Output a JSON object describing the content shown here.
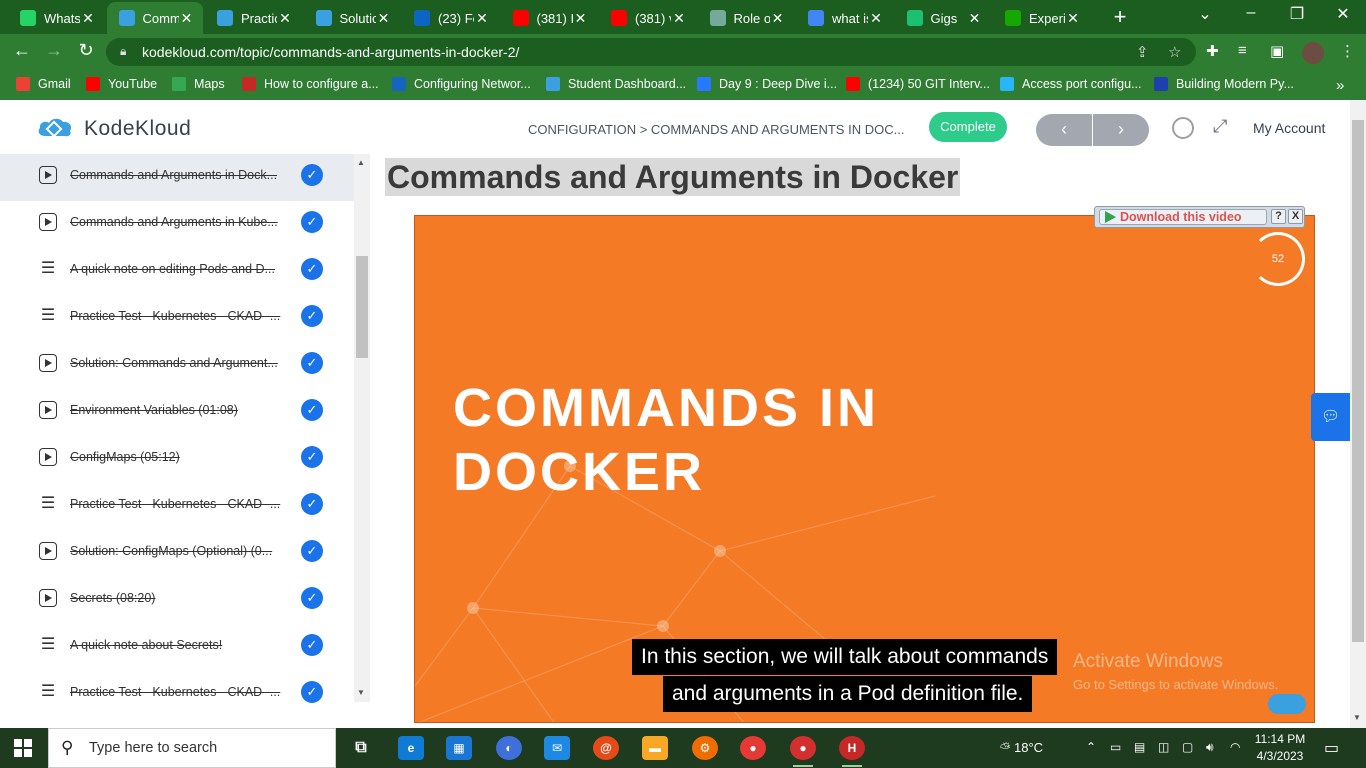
{
  "browser": {
    "tabs": [
      {
        "title": "Whats",
        "icon": "whatsapp-icon",
        "color": "#25d366",
        "active": false
      },
      {
        "title": "Comm",
        "icon": "kodekloud-icon",
        "color": "#3aa0e0",
        "active": true
      },
      {
        "title": "Practic",
        "icon": "kodekloud-icon",
        "color": "#3aa0e0",
        "active": false
      },
      {
        "title": "Solutic",
        "icon": "kodekloud-icon",
        "color": "#3aa0e0",
        "active": false
      },
      {
        "title": "(23) Fe",
        "icon": "linkedin-icon",
        "color": "#0a66c2",
        "active": false
      },
      {
        "title": "(381) I",
        "icon": "youtube-icon",
        "color": "#ff0000",
        "active": false
      },
      {
        "title": "(381) v",
        "icon": "youtube-icon",
        "color": "#ff0000",
        "active": false
      },
      {
        "title": "Role o",
        "icon": "chatgpt-icon",
        "color": "#74aa9c",
        "active": false
      },
      {
        "title": "what is",
        "icon": "google-icon",
        "color": "#4285f4",
        "active": false
      },
      {
        "title": "Gigs",
        "icon": "fiverr-icon",
        "color": "#1dbf73",
        "active": false
      },
      {
        "title": "Experi",
        "icon": "upwork-icon",
        "color": "#14a800",
        "active": false
      }
    ],
    "url": "kodekloud.com/topic/commands-and-arguments-in-docker-2/",
    "bookmarks": [
      {
        "label": "Gmail",
        "icon": "gmail-icon",
        "color": "#ea4335"
      },
      {
        "label": "YouTube",
        "icon": "youtube-icon",
        "color": "#ff0000"
      },
      {
        "label": "Maps",
        "icon": "maps-icon",
        "color": "#34a853"
      },
      {
        "label": "How to configure a...",
        "icon": "bookmark-site-icon",
        "color": "#c62828"
      },
      {
        "label": "Configuring Networ...",
        "icon": "vmware-icon",
        "color": "#1565c0"
      },
      {
        "label": "Student Dashboard...",
        "icon": "kodekloud-icon",
        "color": "#3aa0e0"
      },
      {
        "label": "Day 9 : Deep Dive i...",
        "icon": "diamond-icon",
        "color": "#2979ff"
      },
      {
        "label": "(1234) 50 GIT Interv...",
        "icon": "youtube-icon",
        "color": "#ff0000"
      },
      {
        "label": "Access port configu...",
        "icon": "bookmark-site-icon",
        "color": "#29b6f6"
      },
      {
        "label": "Building Modern Py...",
        "icon": "c-icon",
        "color": "#1e40af"
      }
    ]
  },
  "header": {
    "brand": "KodeKloud",
    "breadcrumb": "CONFIGURATION > COMMANDS AND ARGUMENTS IN DOC...",
    "complete_label": "Complete",
    "prev_label": "‹",
    "next_label": "›",
    "account_label": "My Account"
  },
  "sidebar": {
    "lessons": [
      {
        "title": "Commands and Arguments in Dock...",
        "type": "video",
        "current": true
      },
      {
        "title": "Commands and Arguments in Kube...",
        "type": "video",
        "current": false
      },
      {
        "title": "A quick note on editing Pods and D...",
        "type": "text",
        "current": false
      },
      {
        "title": "Practice Test - Kubernetes - CKAD -...",
        "type": "text",
        "current": false
      },
      {
        "title": "Solution: Commands and Argument...",
        "type": "video",
        "current": false
      },
      {
        "title": "Environment Variables (01:08)",
        "type": "video",
        "current": false
      },
      {
        "title": "ConfigMaps (05:12)",
        "type": "video",
        "current": false
      },
      {
        "title": "Practice Test - Kubernetes - CKAD -...",
        "type": "text",
        "current": false
      },
      {
        "title": "Solution: ConfigMaps (Optional) (0...",
        "type": "video",
        "current": false
      },
      {
        "title": "Secrets (08:20)",
        "type": "video",
        "current": false
      },
      {
        "title": "A quick note about Secrets!",
        "type": "text",
        "current": false
      },
      {
        "title": "Practice Test - Kubernetes - CKAD -...",
        "type": "text",
        "current": false
      }
    ]
  },
  "main": {
    "lesson_title": "Commands and Arguments in Docker",
    "video": {
      "heading_line1": "COMMANDS IN",
      "heading_line2": "DOCKER",
      "timer": "52",
      "caption_line1": "In this section, we will talk about commands",
      "caption_line2": "and arguments in a Pod definition file.",
      "background": "#f47a26"
    },
    "download": {
      "label": "Download this video",
      "help": "?",
      "close": "X"
    },
    "watermark_line1": "Activate Windows",
    "watermark_line2": "Go to Settings to activate Windows."
  },
  "taskbar": {
    "search_placeholder": "Type here to search",
    "temperature": "18°C",
    "time": "11:14 PM",
    "date": "4/3/2023"
  }
}
